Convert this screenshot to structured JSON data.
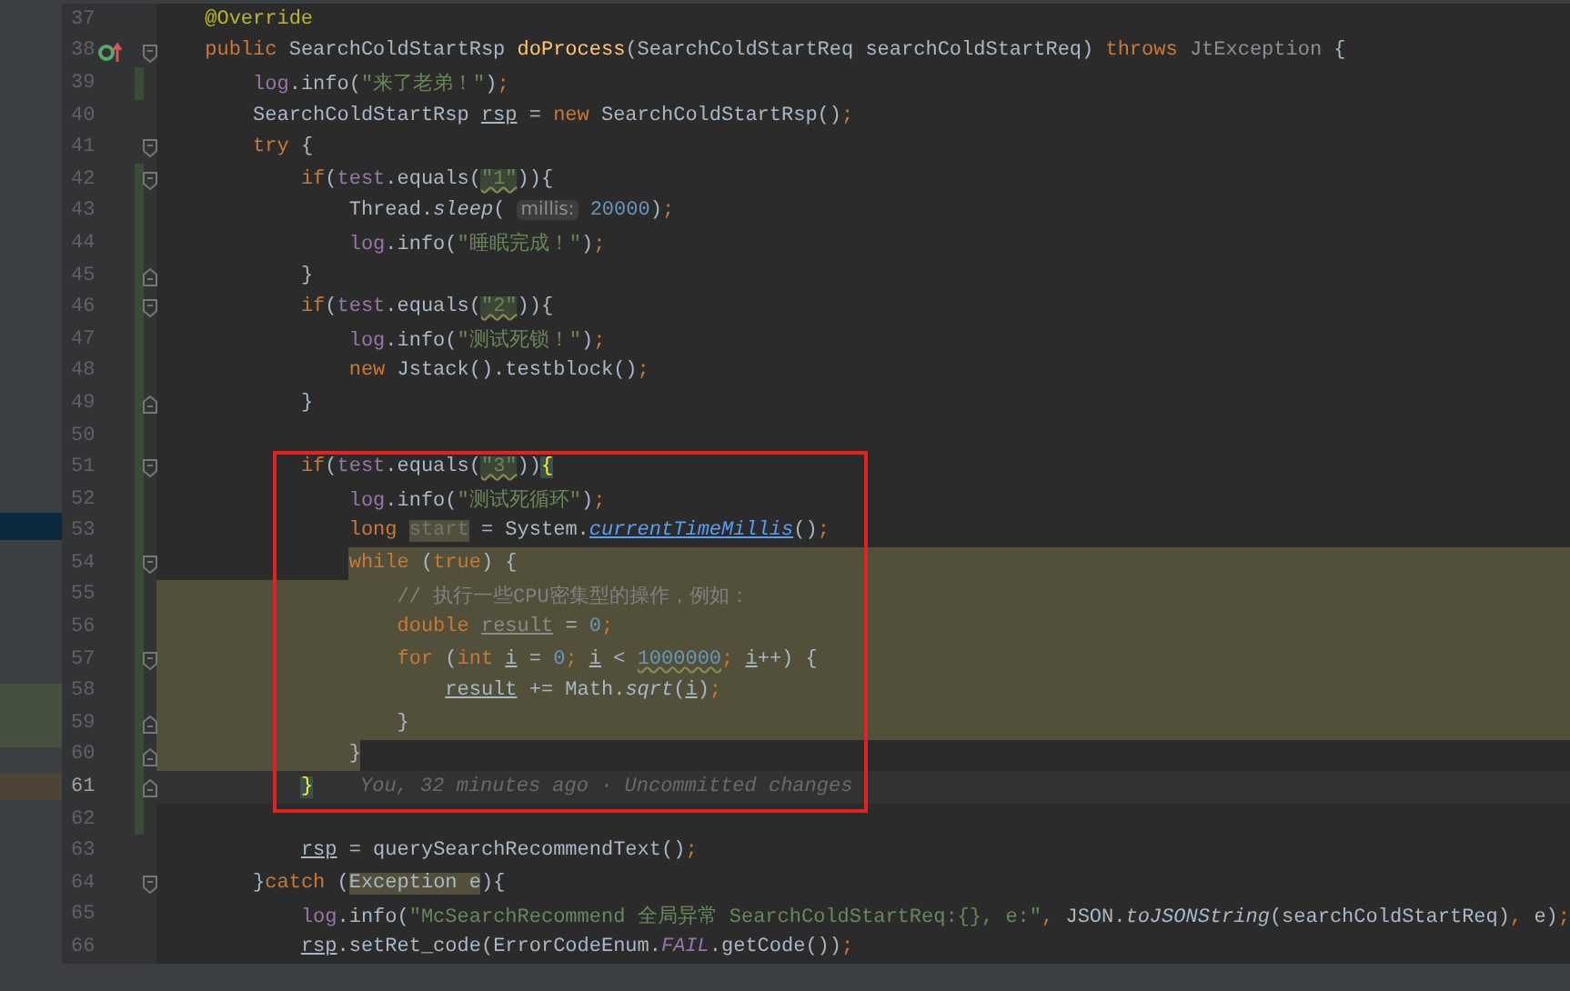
{
  "editor": {
    "lines": [
      {
        "number": "37",
        "kind": "plain",
        "fold_start": false,
        "fold_end": false,
        "changed": false,
        "current": false,
        "tokens": [
          {
            "kind": "annot",
            "text": "    @Override"
          }
        ]
      },
      {
        "number": "38",
        "kind": "plain",
        "fold_start": true,
        "fold_end": false,
        "changed": false,
        "current": false,
        "override_marker": true,
        "tokens": [
          {
            "kind": "kw",
            "text": "    public "
          },
          {
            "kind": "plain",
            "text": "SearchColdStartRsp "
          },
          {
            "kind": "decl",
            "text": "doProcess"
          },
          {
            "kind": "plain",
            "text": "(SearchColdStartReq searchColdStartReq) "
          },
          {
            "kind": "kw",
            "text": "throws "
          },
          {
            "kind": "dim",
            "text": "JtException "
          },
          {
            "kind": "plain",
            "text": "{"
          }
        ]
      },
      {
        "number": "39",
        "kind": "plain",
        "fold_start": false,
        "fold_end": false,
        "changed": true,
        "current": false,
        "tokens": [
          {
            "kind": "field",
            "text": "        log"
          },
          {
            "kind": "plain",
            "text": ".info("
          },
          {
            "kind": "str",
            "text": "\"来了老弟！\""
          },
          {
            "kind": "plain",
            "text": ")"
          },
          {
            "kind": "kw",
            "text": ";"
          }
        ]
      },
      {
        "number": "40",
        "kind": "plain",
        "fold_start": false,
        "fold_end": false,
        "changed": false,
        "current": false,
        "tokens": [
          {
            "kind": "plain",
            "text": "        SearchColdStartRsp "
          },
          {
            "kind": "underlined",
            "text": "rsp"
          },
          {
            "kind": "plain",
            "text": " = "
          },
          {
            "kind": "kw",
            "text": "new "
          },
          {
            "kind": "plain",
            "text": "SearchColdStartRsp()"
          },
          {
            "kind": "kw",
            "text": ";"
          }
        ]
      },
      {
        "number": "41",
        "kind": "plain",
        "fold_start": true,
        "fold_end": false,
        "changed": false,
        "current": false,
        "tokens": [
          {
            "kind": "kw",
            "text": "        try "
          },
          {
            "kind": "plain",
            "text": "{"
          }
        ]
      },
      {
        "number": "42",
        "kind": "plain",
        "fold_start": true,
        "fold_end": false,
        "changed": true,
        "current": false,
        "tokens": [
          {
            "kind": "kw",
            "text": "            if"
          },
          {
            "kind": "plain",
            "text": "("
          },
          {
            "kind": "field",
            "text": "test"
          },
          {
            "kind": "plain",
            "text": ".equals("
          },
          {
            "kind": "str_warn",
            "text": "\"1\""
          },
          {
            "kind": "plain",
            "text": ")){"
          }
        ]
      },
      {
        "number": "43",
        "kind": "plain",
        "fold_start": false,
        "fold_end": false,
        "changed": true,
        "current": false,
        "tokens": [
          {
            "kind": "plain",
            "text": "                Thread."
          },
          {
            "kind": "static_call",
            "text": "sleep"
          },
          {
            "kind": "plain",
            "text": "( "
          },
          {
            "kind": "hint",
            "text": "millis:"
          },
          {
            "kind": "num",
            "text": " 20000"
          },
          {
            "kind": "plain",
            "text": ")"
          },
          {
            "kind": "kw",
            "text": ";"
          }
        ]
      },
      {
        "number": "44",
        "kind": "plain",
        "fold_start": false,
        "fold_end": false,
        "changed": true,
        "current": false,
        "tokens": [
          {
            "kind": "field",
            "text": "                log"
          },
          {
            "kind": "plain",
            "text": ".info("
          },
          {
            "kind": "str",
            "text": "\"睡眠完成！\""
          },
          {
            "kind": "plain",
            "text": ")"
          },
          {
            "kind": "kw",
            "text": ";"
          }
        ]
      },
      {
        "number": "45",
        "kind": "plain",
        "fold_start": false,
        "fold_end": true,
        "changed": true,
        "current": false,
        "tokens": [
          {
            "kind": "plain",
            "text": "            }"
          }
        ]
      },
      {
        "number": "46",
        "kind": "plain",
        "fold_start": true,
        "fold_end": false,
        "changed": true,
        "current": false,
        "tokens": [
          {
            "kind": "kw",
            "text": "            if"
          },
          {
            "kind": "plain",
            "text": "("
          },
          {
            "kind": "field",
            "text": "test"
          },
          {
            "kind": "plain",
            "text": ".equals("
          },
          {
            "kind": "str_warn",
            "text": "\"2\""
          },
          {
            "kind": "plain",
            "text": ")){"
          }
        ]
      },
      {
        "number": "47",
        "kind": "plain",
        "fold_start": false,
        "fold_end": false,
        "changed": true,
        "current": false,
        "tokens": [
          {
            "kind": "field",
            "text": "                log"
          },
          {
            "kind": "plain",
            "text": ".info("
          },
          {
            "kind": "str",
            "text": "\"测试死锁！\""
          },
          {
            "kind": "plain",
            "text": ")"
          },
          {
            "kind": "kw",
            "text": ";"
          }
        ]
      },
      {
        "number": "48",
        "kind": "plain",
        "fold_start": false,
        "fold_end": false,
        "changed": true,
        "current": false,
        "tokens": [
          {
            "kind": "kw",
            "text": "                new "
          },
          {
            "kind": "plain",
            "text": "Jstack().testblock()"
          },
          {
            "kind": "kw",
            "text": ";"
          }
        ]
      },
      {
        "number": "49",
        "kind": "plain",
        "fold_start": false,
        "fold_end": true,
        "changed": true,
        "current": false,
        "tokens": [
          {
            "kind": "plain",
            "text": "            }"
          }
        ]
      },
      {
        "number": "50",
        "kind": "plain",
        "fold_start": false,
        "fold_end": false,
        "changed": true,
        "current": false
      },
      {
        "number": "51",
        "kind": "plain",
        "fold_start": true,
        "fold_end": false,
        "changed": true,
        "current": false,
        "tokens": [
          {
            "kind": "kw",
            "text": "            if"
          },
          {
            "kind": "plain",
            "text": "("
          },
          {
            "kind": "field",
            "text": "test"
          },
          {
            "kind": "plain",
            "text": ".equals("
          },
          {
            "kind": "str_warn",
            "text": "\"3\""
          },
          {
            "kind": "plain",
            "text": "))"
          },
          {
            "kind": "match",
            "text": "{"
          }
        ]
      },
      {
        "number": "52",
        "kind": "plain",
        "fold_start": false,
        "fold_end": false,
        "changed": true,
        "current": false,
        "tokens": [
          {
            "kind": "field",
            "text": "                log"
          },
          {
            "kind": "plain",
            "text": ".info("
          },
          {
            "kind": "str",
            "text": "\"测试死循环\""
          },
          {
            "kind": "plain",
            "text": ")"
          },
          {
            "kind": "kw",
            "text": ";"
          }
        ]
      },
      {
        "number": "53",
        "kind": "plain",
        "fold_start": false,
        "fold_end": false,
        "changed": true,
        "current": false,
        "tokens": [
          {
            "kind": "kw",
            "text": "                long "
          },
          {
            "kind": "unused",
            "text": "start"
          },
          {
            "kind": "plain",
            "text": " = System."
          },
          {
            "kind": "link",
            "text": "currentTimeMillis"
          },
          {
            "kind": "plain",
            "text": "()"
          },
          {
            "kind": "kw",
            "text": ";"
          }
        ]
      },
      {
        "number": "54",
        "kind": "highlight_from_text",
        "fold_start": true,
        "fold_end": false,
        "changed": true,
        "current": false,
        "tokens": [
          {
            "kind": "kw",
            "text": "                while "
          },
          {
            "kind": "plain",
            "text": "("
          },
          {
            "kind": "kw",
            "text": "true"
          },
          {
            "kind": "plain",
            "text": ") {"
          }
        ]
      },
      {
        "number": "55",
        "kind": "highlighted",
        "fold_start": false,
        "fold_end": false,
        "changed": true,
        "current": false,
        "tokens": [
          {
            "kind": "comment",
            "text": "                    // 执行一些CPU密集型的操作，例如："
          }
        ]
      },
      {
        "number": "56",
        "kind": "highlighted",
        "fold_start": false,
        "fold_end": false,
        "changed": true,
        "current": false,
        "tokens": [
          {
            "kind": "kw",
            "text": "                    double "
          },
          {
            "kind": "unused_ul",
            "text": "result"
          },
          {
            "kind": "plain",
            "text": " = "
          },
          {
            "kind": "num",
            "text": "0"
          },
          {
            "kind": "kw",
            "text": ";"
          }
        ]
      },
      {
        "number": "57",
        "kind": "highlighted",
        "fold_start": true,
        "fold_end": false,
        "changed": true,
        "current": false,
        "tokens": [
          {
            "kind": "kw",
            "text": "                    for "
          },
          {
            "kind": "plain",
            "text": "("
          },
          {
            "kind": "kw",
            "text": "int "
          },
          {
            "kind": "underlined",
            "text": "i"
          },
          {
            "kind": "plain",
            "text": " = "
          },
          {
            "kind": "num",
            "text": "0"
          },
          {
            "kind": "kw",
            "text": "; "
          },
          {
            "kind": "underlined",
            "text": "i"
          },
          {
            "kind": "plain",
            "text": " < "
          },
          {
            "kind": "num_warn",
            "text": "1000000"
          },
          {
            "kind": "kw",
            "text": "; "
          },
          {
            "kind": "underlined",
            "text": "i"
          },
          {
            "kind": "plain",
            "text": "++) {"
          }
        ]
      },
      {
        "number": "58",
        "kind": "highlighted",
        "fold_start": false,
        "fold_end": false,
        "changed": true,
        "current": false,
        "tokens": [
          {
            "kind": "underlined",
            "text": "                        result"
          },
          {
            "kind": "plain",
            "text": " += Math."
          },
          {
            "kind": "static_call",
            "text": "sqrt"
          },
          {
            "kind": "plain",
            "text": "("
          },
          {
            "kind": "underlined",
            "text": "i"
          },
          {
            "kind": "plain",
            "text": ")"
          },
          {
            "kind": "kw",
            "text": ";"
          }
        ]
      },
      {
        "number": "59",
        "kind": "highlighted",
        "fold_start": false,
        "fold_end": true,
        "changed": true,
        "current": false,
        "tokens": [
          {
            "kind": "plain",
            "text": "                    }"
          }
        ]
      },
      {
        "number": "60",
        "kind": "highlight_to_text",
        "fold_start": false,
        "fold_end": true,
        "changed": true,
        "current": false,
        "tokens": [
          {
            "kind": "plain",
            "text": "                }"
          }
        ]
      },
      {
        "number": "61",
        "kind": "plain",
        "fold_start": false,
        "fold_end": true,
        "changed": true,
        "current": true,
        "blame": "You, 32 minutes ago · Uncommitted changes",
        "tokens": [
          {
            "kind": "match",
            "text": "            }"
          }
        ]
      },
      {
        "number": "62",
        "kind": "plain",
        "fold_start": false,
        "fold_end": false,
        "changed": true,
        "current": false
      },
      {
        "number": "63",
        "kind": "plain",
        "fold_start": false,
        "fold_end": false,
        "changed": false,
        "current": false,
        "tokens": [
          {
            "kind": "underlined",
            "text": "            rsp"
          },
          {
            "kind": "plain",
            "text": " = querySearchRecommendText()"
          },
          {
            "kind": "kw",
            "text": ";"
          }
        ]
      },
      {
        "number": "64",
        "kind": "plain",
        "fold_start": true,
        "fold_end": false,
        "changed": false,
        "current": false,
        "tokens": [
          {
            "kind": "plain",
            "text": "        }"
          },
          {
            "kind": "kw",
            "text": "catch "
          },
          {
            "kind": "plain",
            "text": "("
          },
          {
            "kind": "occurrence",
            "text": "Exception e"
          },
          {
            "kind": "plain",
            "text": "){"
          }
        ]
      },
      {
        "number": "65",
        "kind": "plain",
        "fold_start": false,
        "fold_end": false,
        "changed": false,
        "current": false,
        "tokens": [
          {
            "kind": "field",
            "text": "            log"
          },
          {
            "kind": "plain",
            "text": ".info("
          },
          {
            "kind": "str",
            "text": "\"McSearchRecommend 全局异常 SearchColdStartReq:{}, e:\""
          },
          {
            "kind": "kw",
            "text": ", "
          },
          {
            "kind": "plain",
            "text": "JSON."
          },
          {
            "kind": "static_call",
            "text": "toJSONString"
          },
          {
            "kind": "plain",
            "text": "(searchColdStartReq)"
          },
          {
            "kind": "kw",
            "text": ", "
          },
          {
            "kind": "plain",
            "text": "e)"
          },
          {
            "kind": "kw",
            "text": ";"
          }
        ]
      },
      {
        "number": "66",
        "kind": "plain",
        "fold_start": false,
        "fold_end": false,
        "changed": false,
        "current": false,
        "tokens": [
          {
            "kind": "underlined",
            "text": "            rsp"
          },
          {
            "kind": "plain",
            "text": ".setRet_code(ErrorCodeEnum."
          },
          {
            "kind": "static_field",
            "text": "FAIL"
          },
          {
            "kind": "plain",
            "text": ".getCode())"
          },
          {
            "kind": "kw",
            "text": ";"
          }
        ]
      }
    ]
  }
}
